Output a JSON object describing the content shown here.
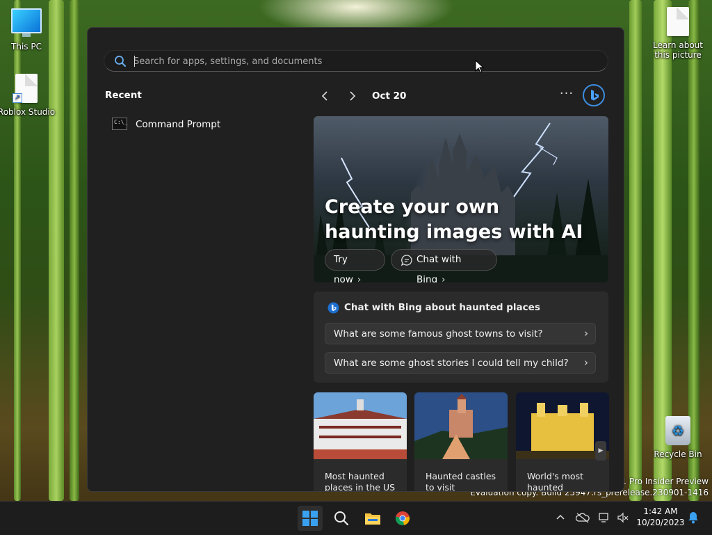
{
  "desktop": {
    "icons": {
      "this_pc": "This PC",
      "roblox": "Roblox Studio",
      "learn": "Learn about this picture",
      "recycle": "Recycle Bin"
    },
    "watermark_line1": "s 11 Pro Insider Preview",
    "watermark_line2": "Evaluation copy. Build 25947.rs_prerelease.230901-1416"
  },
  "start_menu": {
    "search": {
      "placeholder": "Search for apps, settings, and documents",
      "value": ""
    },
    "recent": {
      "title": "Recent",
      "items": [
        {
          "label": "Command Prompt",
          "icon": "command-prompt-icon"
        }
      ]
    },
    "widget": {
      "date": "Oct 20",
      "more_label": "···",
      "hero": {
        "headline": "Create your own haunting images with AI",
        "try_label": "Try now",
        "chat_label": "Chat with Bing"
      },
      "chat": {
        "title": "Chat with Bing about haunted places",
        "questions": [
          "What are some famous ghost towns to visit?",
          "What are some ghost stories I could tell my child?"
        ]
      },
      "cards": [
        "Most haunted places in the US",
        "Haunted castles to visit",
        "World's most haunted"
      ]
    }
  },
  "taskbar": {
    "apps": [
      "start-icon",
      "search-icon",
      "file-explorer-icon",
      "chrome-icon"
    ],
    "clock": {
      "time": "1:42 AM",
      "date": "10/20/2023"
    }
  },
  "colors": {
    "accent": "#3d8de0",
    "menu_bg": "#202020",
    "card_bg": "#2b2b2b"
  }
}
